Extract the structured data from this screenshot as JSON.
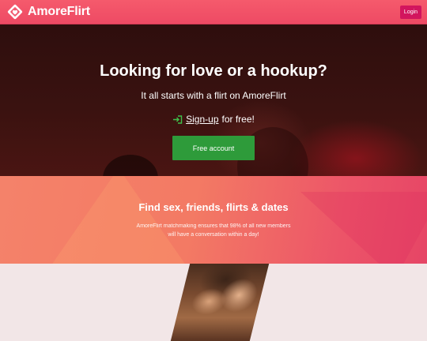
{
  "header": {
    "brand": "AmoreFlirt",
    "login_label": "Login"
  },
  "hero": {
    "title": "Looking for love or a hookup?",
    "subtitle": "It all starts with a flirt on AmoreFlirt",
    "signup_link": "Sign-up",
    "signup_rest": "for free!",
    "cta_label": "Free account"
  },
  "features": {
    "title": "Find sex, friends, flirts & dates",
    "text": "AmoreFlirt matchmaking ensures that 98% of all new members will have a conversation within a day!"
  },
  "icons": {
    "logo": "heart-diamond-icon",
    "signup": "sign-in-arrow-icon"
  },
  "colors": {
    "header": "#f55a6c",
    "login_button": "#d2155e",
    "cta_button": "#2e9b3a",
    "signup_icon": "#3fbf4a"
  }
}
